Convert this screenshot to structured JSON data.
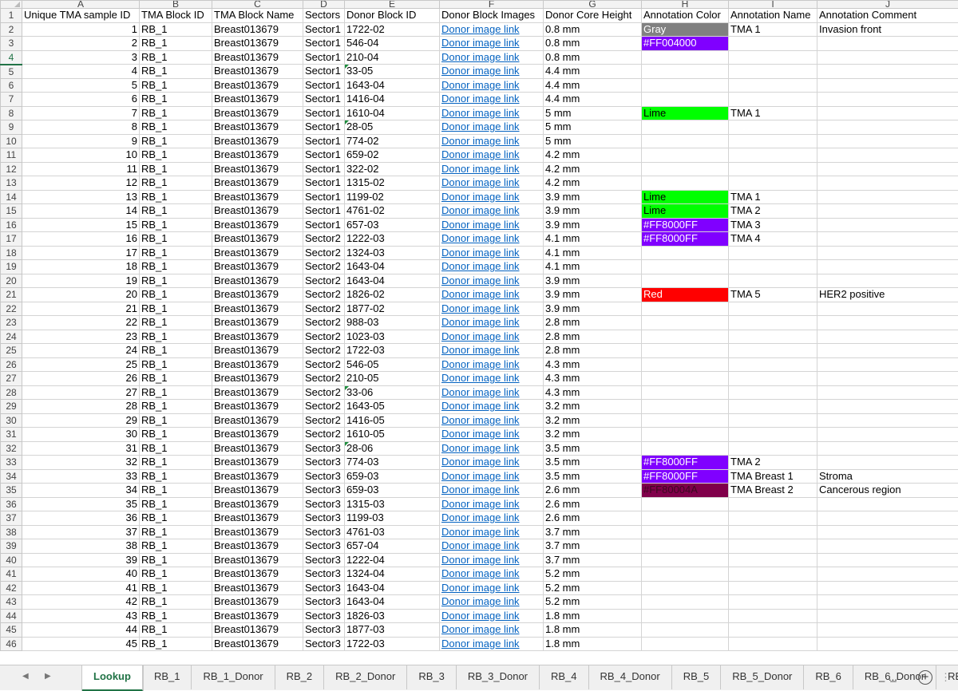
{
  "columns": [
    "A",
    "B",
    "C",
    "D",
    "E",
    "F",
    "G",
    "H",
    "I",
    "J"
  ],
  "headers": [
    "Unique TMA sample ID",
    "TMA Block ID",
    "TMA Block Name",
    "Sectors",
    "Donor Block ID",
    "Donor Block Images",
    "Donor Core Height",
    "Annotation Color",
    "Annotation Name",
    "Annotation Comment"
  ],
  "header_row_num": "1",
  "colors": {
    "Gray": "#808080",
    "Purple": "#8000ff",
    "Lime": "#00ff00",
    "Red": "#ff0000",
    "Maroon": "#80004a"
  },
  "rows": [
    {
      "n": "2",
      "id": "1",
      "block": "RB_1",
      "name": "Breast013679",
      "sector": "Sector1",
      "donor": "1722-02",
      "img": "Donor image link",
      "height": "0.8 mm",
      "color": "Gray",
      "cc": "Gray",
      "ann": "TMA 1",
      "comment": "Invasion front"
    },
    {
      "n": "3",
      "id": "2",
      "block": "RB_1",
      "name": "Breast013679",
      "sector": "Sector1",
      "donor": "546-04",
      "img": "Donor image link",
      "height": "0.8 mm",
      "color": "#FF004000",
      "cc": "Purple",
      "ann": "",
      "comment": ""
    },
    {
      "n": "4",
      "id": "3",
      "block": "RB_1",
      "name": "Breast013679",
      "sector": "Sector1",
      "donor": "210-04",
      "img": "Donor image link",
      "height": "0.8 mm",
      "color": "",
      "cc": "",
      "ann": "",
      "comment": "",
      "sel": true
    },
    {
      "n": "5",
      "id": "4",
      "block": "RB_1",
      "name": "Breast013679",
      "sector": "Sector1",
      "donor": "33-05",
      "img": "Donor image link",
      "height": "4.4 mm",
      "color": "",
      "cc": "",
      "ann": "",
      "comment": "",
      "tri": true
    },
    {
      "n": "6",
      "id": "5",
      "block": "RB_1",
      "name": "Breast013679",
      "sector": "Sector1",
      "donor": "1643-04",
      "img": "Donor image link",
      "height": "4.4 mm",
      "color": "",
      "cc": "",
      "ann": "",
      "comment": ""
    },
    {
      "n": "7",
      "id": "6",
      "block": "RB_1",
      "name": "Breast013679",
      "sector": "Sector1",
      "donor": "1416-04",
      "img": "Donor image link",
      "height": "4.4 mm",
      "color": "",
      "cc": "",
      "ann": "",
      "comment": ""
    },
    {
      "n": "8",
      "id": "7",
      "block": "RB_1",
      "name": "Breast013679",
      "sector": "Sector1",
      "donor": "1610-04",
      "img": "Donor image link",
      "height": "5 mm",
      "color": "Lime",
      "cc": "Lime",
      "ann": "TMA 1",
      "comment": ""
    },
    {
      "n": "9",
      "id": "8",
      "block": "RB_1",
      "name": "Breast013679",
      "sector": "Sector1",
      "donor": "28-05",
      "img": "Donor image link",
      "height": "5 mm",
      "color": "",
      "cc": "",
      "ann": "",
      "comment": "",
      "tri": true
    },
    {
      "n": "10",
      "id": "9",
      "block": "RB_1",
      "name": "Breast013679",
      "sector": "Sector1",
      "donor": "774-02",
      "img": "Donor image link",
      "height": "5 mm",
      "color": "",
      "cc": "",
      "ann": "",
      "comment": ""
    },
    {
      "n": "11",
      "id": "10",
      "block": "RB_1",
      "name": "Breast013679",
      "sector": "Sector1",
      "donor": "659-02",
      "img": "Donor image link",
      "height": "4.2 mm",
      "color": "",
      "cc": "",
      "ann": "",
      "comment": ""
    },
    {
      "n": "12",
      "id": "11",
      "block": "RB_1",
      "name": "Breast013679",
      "sector": "Sector1",
      "donor": "322-02",
      "img": "Donor image link",
      "height": "4.2 mm",
      "color": "",
      "cc": "",
      "ann": "",
      "comment": ""
    },
    {
      "n": "13",
      "id": "12",
      "block": "RB_1",
      "name": "Breast013679",
      "sector": "Sector1",
      "donor": "1315-02",
      "img": "Donor image link",
      "height": "4.2 mm",
      "color": "",
      "cc": "",
      "ann": "",
      "comment": ""
    },
    {
      "n": "14",
      "id": "13",
      "block": "RB_1",
      "name": "Breast013679",
      "sector": "Sector1",
      "donor": "1199-02",
      "img": "Donor image link",
      "height": "3.9 mm",
      "color": "Lime",
      "cc": "Lime",
      "ann": "TMA 1",
      "comment": ""
    },
    {
      "n": "15",
      "id": "14",
      "block": "RB_1",
      "name": "Breast013679",
      "sector": "Sector1",
      "donor": "4761-02",
      "img": "Donor image link",
      "height": "3.9 mm",
      "color": "Lime",
      "cc": "Lime",
      "ann": "TMA 2",
      "comment": ""
    },
    {
      "n": "16",
      "id": "15",
      "block": "RB_1",
      "name": "Breast013679",
      "sector": "Sector1",
      "donor": "657-03",
      "img": "Donor image link",
      "height": "3.9 mm",
      "color": "#FF8000FF",
      "cc": "Purple",
      "ann": "TMA 3",
      "comment": ""
    },
    {
      "n": "17",
      "id": "16",
      "block": "RB_1",
      "name": "Breast013679",
      "sector": "Sector2",
      "donor": "1222-03",
      "img": "Donor image link",
      "height": "4.1 mm",
      "color": "#FF8000FF",
      "cc": "Purple",
      "ann": "TMA 4",
      "comment": ""
    },
    {
      "n": "18",
      "id": "17",
      "block": "RB_1",
      "name": "Breast013679",
      "sector": "Sector2",
      "donor": "1324-03",
      "img": "Donor image link",
      "height": "4.1 mm",
      "color": "",
      "cc": "",
      "ann": "",
      "comment": ""
    },
    {
      "n": "19",
      "id": "18",
      "block": "RB_1",
      "name": "Breast013679",
      "sector": "Sector2",
      "donor": "1643-04",
      "img": "Donor image link",
      "height": "4.1 mm",
      "color": "",
      "cc": "",
      "ann": "",
      "comment": ""
    },
    {
      "n": "20",
      "id": "19",
      "block": "RB_1",
      "name": "Breast013679",
      "sector": "Sector2",
      "donor": "1643-04",
      "img": "Donor image link",
      "height": "3.9 mm",
      "color": "",
      "cc": "",
      "ann": "",
      "comment": ""
    },
    {
      "n": "21",
      "id": "20",
      "block": "RB_1",
      "name": "Breast013679",
      "sector": "Sector2",
      "donor": "1826-02",
      "img": "Donor image link",
      "height": "3.9 mm",
      "color": "Red",
      "cc": "Red",
      "ann": "TMA 5",
      "comment": "HER2 positive"
    },
    {
      "n": "22",
      "id": "21",
      "block": "RB_1",
      "name": "Breast013679",
      "sector": "Sector2",
      "donor": "1877-02",
      "img": "Donor image link",
      "height": "3.9 mm",
      "color": "",
      "cc": "",
      "ann": "",
      "comment": ""
    },
    {
      "n": "23",
      "id": "22",
      "block": "RB_1",
      "name": "Breast013679",
      "sector": "Sector2",
      "donor": "988-03",
      "img": "Donor image link",
      "height": "2.8 mm",
      "color": "",
      "cc": "",
      "ann": "",
      "comment": ""
    },
    {
      "n": "24",
      "id": "23",
      "block": "RB_1",
      "name": "Breast013679",
      "sector": "Sector2",
      "donor": "1023-03",
      "img": "Donor image link",
      "height": "2.8 mm",
      "color": "",
      "cc": "",
      "ann": "",
      "comment": ""
    },
    {
      "n": "25",
      "id": "24",
      "block": "RB_1",
      "name": "Breast013679",
      "sector": "Sector2",
      "donor": "1722-03",
      "img": "Donor image link",
      "height": "2.8 mm",
      "color": "",
      "cc": "",
      "ann": "",
      "comment": ""
    },
    {
      "n": "26",
      "id": "25",
      "block": "RB_1",
      "name": "Breast013679",
      "sector": "Sector2",
      "donor": "546-05",
      "img": "Donor image link",
      "height": "4.3 mm",
      "color": "",
      "cc": "",
      "ann": "",
      "comment": ""
    },
    {
      "n": "27",
      "id": "26",
      "block": "RB_1",
      "name": "Breast013679",
      "sector": "Sector2",
      "donor": "210-05",
      "img": "Donor image link",
      "height": "4.3 mm",
      "color": "",
      "cc": "",
      "ann": "",
      "comment": ""
    },
    {
      "n": "28",
      "id": "27",
      "block": "RB_1",
      "name": "Breast013679",
      "sector": "Sector2",
      "donor": "33-06",
      "img": "Donor image link",
      "height": "4.3 mm",
      "color": "",
      "cc": "",
      "ann": "",
      "comment": "",
      "tri": true
    },
    {
      "n": "29",
      "id": "28",
      "block": "RB_1",
      "name": "Breast013679",
      "sector": "Sector2",
      "donor": "1643-05",
      "img": "Donor image link",
      "height": "3.2 mm",
      "color": "",
      "cc": "",
      "ann": "",
      "comment": ""
    },
    {
      "n": "30",
      "id": "29",
      "block": "RB_1",
      "name": "Breast013679",
      "sector": "Sector2",
      "donor": "1416-05",
      "img": "Donor image link",
      "height": "3.2 mm",
      "color": "",
      "cc": "",
      "ann": "",
      "comment": ""
    },
    {
      "n": "31",
      "id": "30",
      "block": "RB_1",
      "name": "Breast013679",
      "sector": "Sector2",
      "donor": "1610-05",
      "img": "Donor image link",
      "height": "3.2 mm",
      "color": "",
      "cc": "",
      "ann": "",
      "comment": ""
    },
    {
      "n": "32",
      "id": "31",
      "block": "RB_1",
      "name": "Breast013679",
      "sector": "Sector3",
      "donor": "28-06",
      "img": "Donor image link",
      "height": "3.5 mm",
      "color": "",
      "cc": "",
      "ann": "",
      "comment": "",
      "tri": true
    },
    {
      "n": "33",
      "id": "32",
      "block": "RB_1",
      "name": "Breast013679",
      "sector": "Sector3",
      "donor": "774-03",
      "img": "Donor image link",
      "height": "3.5 mm",
      "color": "#FF8000FF",
      "cc": "Purple",
      "ann": "TMA 2",
      "comment": ""
    },
    {
      "n": "34",
      "id": "33",
      "block": "RB_1",
      "name": "Breast013679",
      "sector": "Sector3",
      "donor": "659-03",
      "img": "Donor image link",
      "height": "3.5 mm",
      "color": "#FF8000FF",
      "cc": "Purple",
      "ann": "TMA Breast 1",
      "comment": "Stroma"
    },
    {
      "n": "35",
      "id": "34",
      "block": "RB_1",
      "name": "Breast013679",
      "sector": "Sector3",
      "donor": "659-03",
      "img": "Donor image link",
      "height": "2.6 mm",
      "color": "#FF80004A",
      "cc": "Maroon",
      "ann": "TMA Breast 2",
      "comment": "Cancerous region"
    },
    {
      "n": "36",
      "id": "35",
      "block": "RB_1",
      "name": "Breast013679",
      "sector": "Sector3",
      "donor": "1315-03",
      "img": "Donor image link",
      "height": "2.6 mm",
      "color": "",
      "cc": "",
      "ann": "",
      "comment": ""
    },
    {
      "n": "37",
      "id": "36",
      "block": "RB_1",
      "name": "Breast013679",
      "sector": "Sector3",
      "donor": "1199-03",
      "img": "Donor image link",
      "height": "2.6 mm",
      "color": "",
      "cc": "",
      "ann": "",
      "comment": ""
    },
    {
      "n": "38",
      "id": "37",
      "block": "RB_1",
      "name": "Breast013679",
      "sector": "Sector3",
      "donor": "4761-03",
      "img": "Donor image link",
      "height": "3.7 mm",
      "color": "",
      "cc": "",
      "ann": "",
      "comment": ""
    },
    {
      "n": "39",
      "id": "38",
      "block": "RB_1",
      "name": "Breast013679",
      "sector": "Sector3",
      "donor": "657-04",
      "img": "Donor image link",
      "height": "3.7 mm",
      "color": "",
      "cc": "",
      "ann": "",
      "comment": ""
    },
    {
      "n": "40",
      "id": "39",
      "block": "RB_1",
      "name": "Breast013679",
      "sector": "Sector3",
      "donor": "1222-04",
      "img": "Donor image link",
      "height": "3.7 mm",
      "color": "",
      "cc": "",
      "ann": "",
      "comment": ""
    },
    {
      "n": "41",
      "id": "40",
      "block": "RB_1",
      "name": "Breast013679",
      "sector": "Sector3",
      "donor": "1324-04",
      "img": "Donor image link",
      "height": "5.2 mm",
      "color": "",
      "cc": "",
      "ann": "",
      "comment": ""
    },
    {
      "n": "42",
      "id": "41",
      "block": "RB_1",
      "name": "Breast013679",
      "sector": "Sector3",
      "donor": "1643-04",
      "img": "Donor image link",
      "height": "5.2 mm",
      "color": "",
      "cc": "",
      "ann": "",
      "comment": ""
    },
    {
      "n": "43",
      "id": "42",
      "block": "RB_1",
      "name": "Breast013679",
      "sector": "Sector3",
      "donor": "1643-04",
      "img": "Donor image link",
      "height": "5.2 mm",
      "color": "",
      "cc": "",
      "ann": "",
      "comment": ""
    },
    {
      "n": "44",
      "id": "43",
      "block": "RB_1",
      "name": "Breast013679",
      "sector": "Sector3",
      "donor": "1826-03",
      "img": "Donor image link",
      "height": "1.8 mm",
      "color": "",
      "cc": "",
      "ann": "",
      "comment": ""
    },
    {
      "n": "45",
      "id": "44",
      "block": "RB_1",
      "name": "Breast013679",
      "sector": "Sector3",
      "donor": "1877-03",
      "img": "Donor image link",
      "height": "1.8 mm",
      "color": "",
      "cc": "",
      "ann": "",
      "comment": ""
    },
    {
      "n": "46",
      "id": "45",
      "block": "RB_1",
      "name": "Breast013679",
      "sector": "Sector3",
      "donor": "1722-03",
      "img": "Donor image link",
      "height": "1.8 mm",
      "color": "",
      "cc": "",
      "ann": "",
      "comment": ""
    }
  ],
  "tabs": [
    "Lookup",
    "RB_1",
    "RB_1_Donor",
    "RB_2",
    "RB_2_Donor",
    "RB_3",
    "RB_3_Donor",
    "RB_4",
    "RB_4_Donor",
    "RB_5",
    "RB_5_Donor",
    "RB_6",
    "RB_6_Donor",
    "RE"
  ],
  "active_tab": "Lookup",
  "tab_more": "...",
  "add_sheet_icon": "plus-circle-icon",
  "nav_prev_icon": "triangle-left-icon",
  "nav_next_icon": "triangle-right-icon"
}
